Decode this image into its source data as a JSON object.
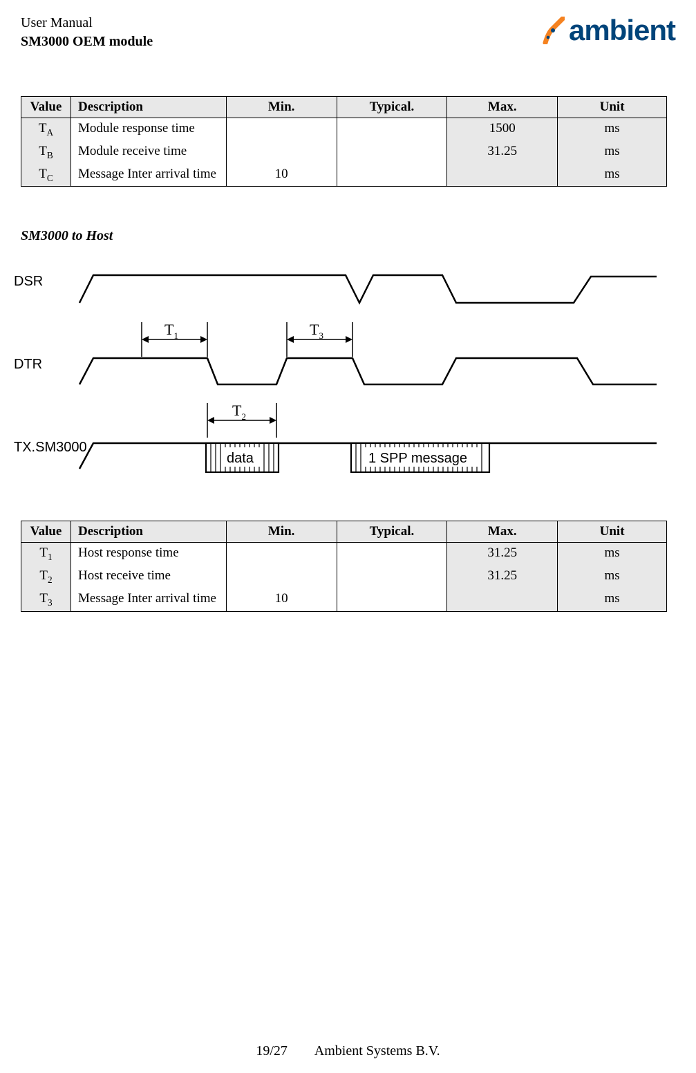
{
  "header": {
    "line1": "User Manual",
    "line2": "SM3000 OEM module",
    "logo_text": "ambient"
  },
  "table1": {
    "headers": {
      "value": "Value",
      "desc": "Description",
      "min": "Min.",
      "typ": "Typical.",
      "max": "Max.",
      "unit": "Unit"
    },
    "rows": [
      {
        "value_main": "T",
        "value_sub": "A",
        "desc": "Module response time",
        "min": "",
        "typ": "",
        "max": "1500",
        "unit": "ms"
      },
      {
        "value_main": "T",
        "value_sub": "B",
        "desc": "Module receive time",
        "min": "",
        "typ": "",
        "max": "31.25",
        "unit": "ms"
      },
      {
        "value_main": "T",
        "value_sub": "C",
        "desc": "Message Inter arrival time",
        "min": "10",
        "typ": "",
        "max": "",
        "unit": "ms"
      }
    ]
  },
  "section_title": "SM3000 to Host",
  "diagram": {
    "signals": [
      "DSR",
      "DTR",
      "TX.SM3000"
    ],
    "labels": {
      "t1": "T",
      "t1sub": "1",
      "t2": "T",
      "t2sub": "2",
      "t3": "T",
      "t3sub": "3",
      "data": "data",
      "spp": "1 SPP message"
    }
  },
  "table2": {
    "headers": {
      "value": "Value",
      "desc": "Description",
      "min": "Min.",
      "typ": "Typical.",
      "max": "Max.",
      "unit": "Unit"
    },
    "rows": [
      {
        "value_main": "T",
        "value_sub": "1",
        "desc": "Host response time",
        "min": "",
        "typ": "",
        "max": "31.25",
        "unit": "ms"
      },
      {
        "value_main": "T",
        "value_sub": "2",
        "desc": "Host receive time",
        "min": "",
        "typ": "",
        "max": "31.25",
        "unit": "ms"
      },
      {
        "value_main": "T",
        "value_sub": "3",
        "desc": "Message Inter arrival time",
        "min": "10",
        "typ": "",
        "max": "",
        "unit": "ms"
      }
    ]
  },
  "footer": {
    "page": "19/27",
    "company": "Ambient Systems B.V."
  }
}
